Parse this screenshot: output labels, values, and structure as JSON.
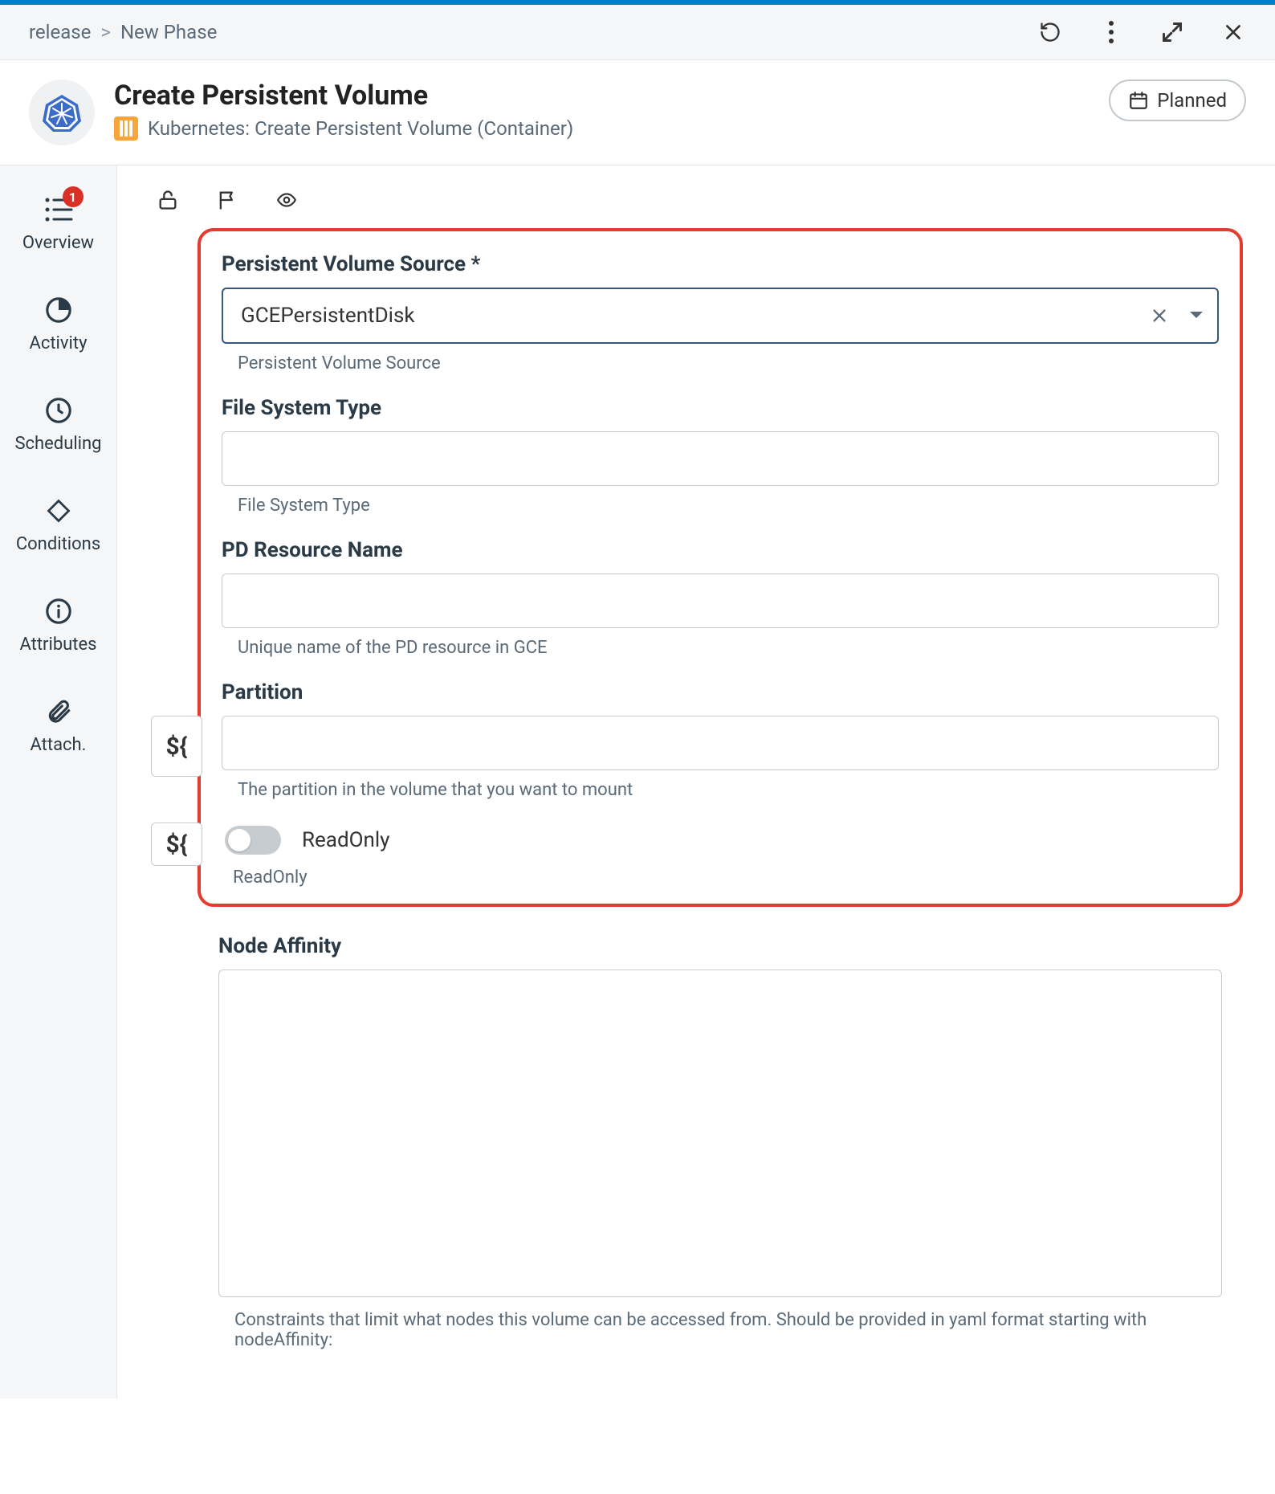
{
  "breadcrumb": {
    "root": "release",
    "current": "New Phase"
  },
  "header": {
    "title": "Create Persistent Volume",
    "subtitle": "Kubernetes: Create Persistent Volume (Container)",
    "status": "Planned"
  },
  "sidebar": {
    "items": [
      {
        "label": "Overview",
        "badge": "1"
      },
      {
        "label": "Activity"
      },
      {
        "label": "Scheduling"
      },
      {
        "label": "Conditions"
      },
      {
        "label": "Attributes"
      },
      {
        "label": "Attach."
      }
    ]
  },
  "form": {
    "volume_source": {
      "label": "Persistent Volume Source *",
      "value": "GCEPersistentDisk",
      "help": "Persistent Volume Source"
    },
    "fs_type": {
      "label": "File System Type",
      "value": "",
      "help": "File System Type"
    },
    "pd_name": {
      "label": "PD Resource Name",
      "value": "",
      "help": "Unique name of the PD resource in GCE"
    },
    "partition": {
      "label": "Partition",
      "value": "",
      "help": "The partition in the volume that you want to mount"
    },
    "readonly": {
      "toggle_label": "ReadOnly",
      "help": "ReadOnly"
    },
    "node_affinity": {
      "label": "Node Affinity",
      "value": "",
      "help": "Constraints that limit what nodes this volume can be accessed from. Should be provided in yaml format starting with nodeAffinity:"
    },
    "var_chip": "${"
  }
}
